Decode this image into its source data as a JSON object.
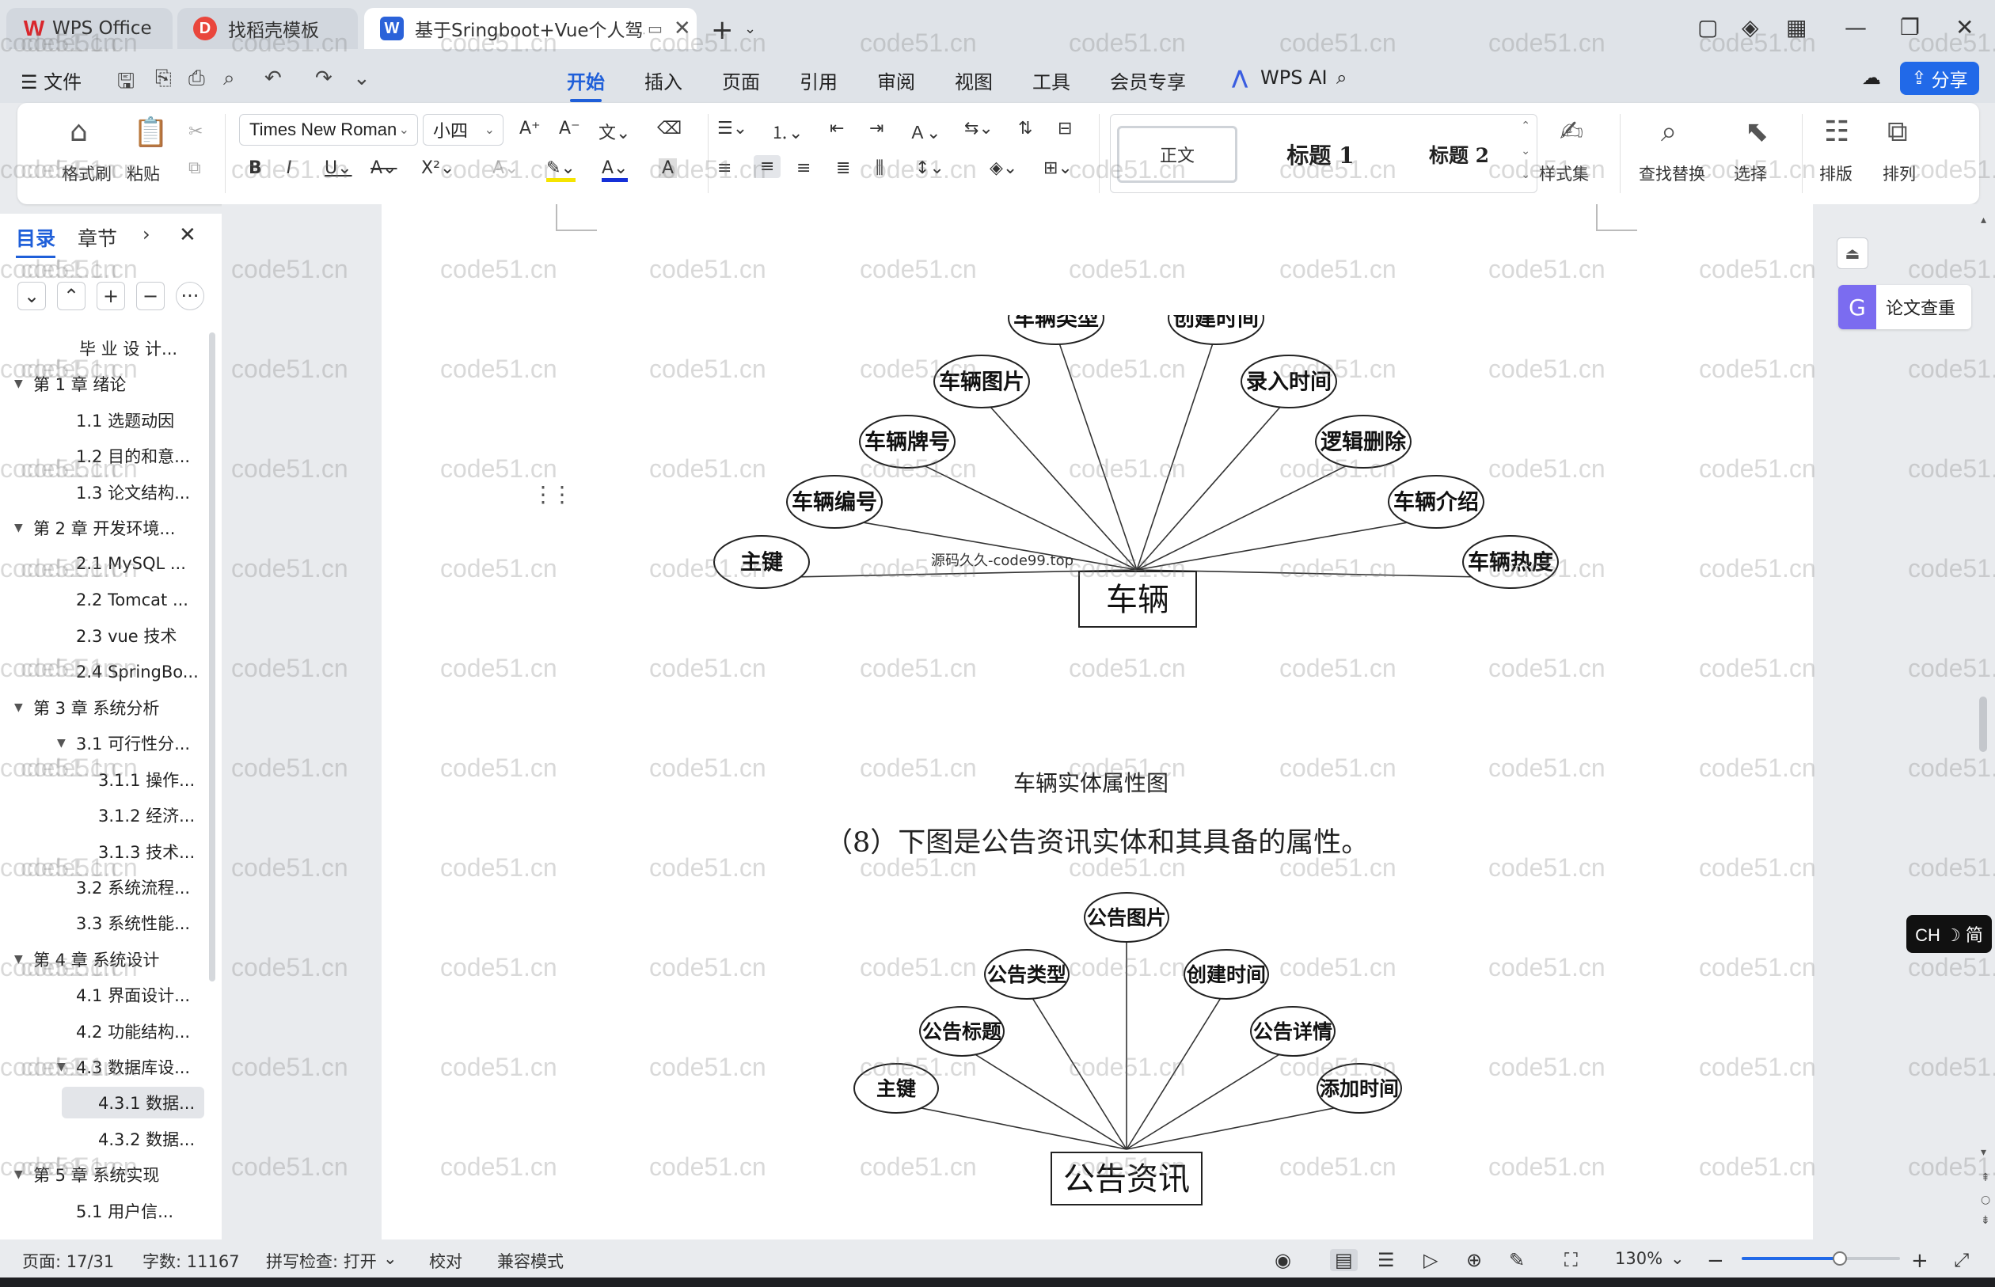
{
  "tabs": [
    {
      "label": "WPS Office",
      "icon": "wps-logo-icon"
    },
    {
      "label": "找稻壳模板",
      "icon": "docer-icon"
    },
    {
      "label": "基于Sringboot+Vue个人驾校",
      "icon": "word-doc-icon"
    }
  ],
  "menu": {
    "file": "☰ 文件",
    "tabs": [
      "开始",
      "插入",
      "页面",
      "引用",
      "审阅",
      "视图",
      "工具",
      "会员专享"
    ],
    "active_tab": "开始",
    "wps_ai": "WPS AI",
    "share": "分享"
  },
  "ribbon": {
    "format_painter": "格式刷",
    "paste": "粘贴",
    "font_name": "Times New Roman",
    "font_size": "小四",
    "styles": {
      "normal": "正文",
      "heading1": "标题 1",
      "heading2": "标题 2"
    },
    "style_set": "样式集",
    "find_replace": "查找替换",
    "select": "选择",
    "layout": "排版",
    "arrange": "排列"
  },
  "nav": {
    "tab_toc": "目录",
    "tab_section": "章节",
    "items": [
      {
        "label": "毕 业 设 计...",
        "level": 1,
        "arrow": false
      },
      {
        "label": "第 1 章  绪论",
        "level": 0,
        "arrow": true
      },
      {
        "label": "1.1 选题动因",
        "level": 1,
        "arrow": false
      },
      {
        "label": "1.2 目的和意...",
        "level": 1,
        "arrow": false
      },
      {
        "label": "1.3 论文结构...",
        "level": 1,
        "arrow": false
      },
      {
        "label": "第 2 章  开发环境...",
        "level": 0,
        "arrow": true
      },
      {
        "label": "2.1 MySQL ...",
        "level": 1,
        "arrow": false
      },
      {
        "label": "2.2 Tomcat  ...",
        "level": 1,
        "arrow": false
      },
      {
        "label": "2.3 vue 技术",
        "level": 1,
        "arrow": false
      },
      {
        "label": "2.4 SpringBo...",
        "level": 1,
        "arrow": false
      },
      {
        "label": "第 3 章  系统分析",
        "level": 0,
        "arrow": true
      },
      {
        "label": "3.1 可行性分...",
        "level": 1,
        "arrow": true
      },
      {
        "label": "3.1.1 操作...",
        "level": 2,
        "arrow": false
      },
      {
        "label": "3.1.2 经济...",
        "level": 2,
        "arrow": false
      },
      {
        "label": "3.1.3 技术...",
        "level": 2,
        "arrow": false
      },
      {
        "label": "3.2 系统流程...",
        "level": 1,
        "arrow": false
      },
      {
        "label": "3.3 系统性能...",
        "level": 1,
        "arrow": false
      },
      {
        "label": "第 4 章  系统设计",
        "level": 0,
        "arrow": true
      },
      {
        "label": "4.1 界面设计...",
        "level": 1,
        "arrow": false
      },
      {
        "label": "4.2 功能结构...",
        "level": 1,
        "arrow": false
      },
      {
        "label": "4.3 数据库设...",
        "level": 1,
        "arrow": true
      },
      {
        "label": "4.3.1  数据...",
        "level": 2,
        "arrow": false,
        "selected": true
      },
      {
        "label": "4.3.2  数据...",
        "level": 2,
        "arrow": false
      },
      {
        "label": "第 5 章  系统实现",
        "level": 0,
        "arrow": true
      },
      {
        "label": "5.1 用户信...",
        "level": 1,
        "arrow": false
      }
    ]
  },
  "document": {
    "vehicle_entity": "车辆",
    "vehicle_attributes": [
      "主键",
      "车辆编号",
      "车辆牌号",
      "车辆图片",
      "车辆类型",
      "创建时间",
      "录入时间",
      "逻辑删除",
      "车辆介绍",
      "车辆热度"
    ],
    "vehicle_overlay_text": "源码久久-code99.top",
    "vehicle_caption": "车辆实体属性图",
    "paragraph": "（8）下图是公告资讯实体和其具备的属性。",
    "notice_entity": "公告资讯",
    "notice_attributes": [
      "主键",
      "公告标题",
      "公告类型",
      "公告图片",
      "创建时间",
      "公告详情",
      "添加时间"
    ]
  },
  "watermark": "code51.cn",
  "right_panel": {
    "plagiarism": "论文查重",
    "ime": "CH ☽ 简"
  },
  "status": {
    "page": "页面: 17/31",
    "words": "字数: 11167",
    "spell": "拼写检查: 打开",
    "proof": "校对",
    "compat": "兼容模式",
    "zoom": "130%",
    "zoom_fraction": 0.62
  }
}
